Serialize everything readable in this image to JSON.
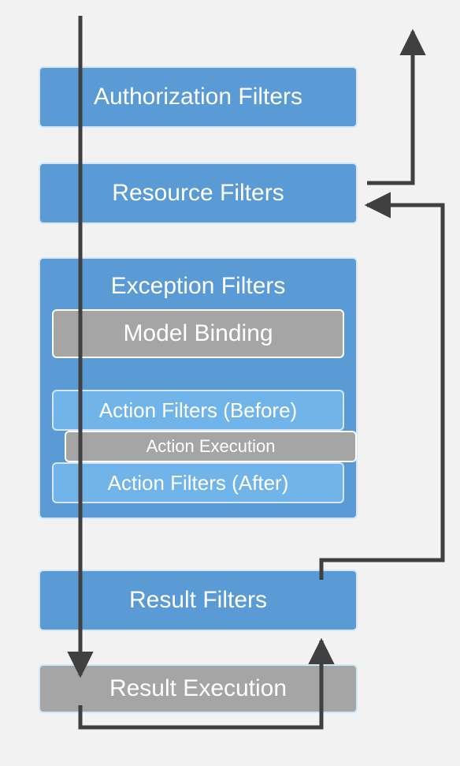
{
  "colors": {
    "blue": "#5b9bd5",
    "lightBlue": "#71b4ea",
    "gray": "#a5a5a5",
    "bg": "#f2f2f2",
    "arrow": "#404040"
  },
  "boxes": {
    "auth": {
      "label": "Authorization Filters"
    },
    "resource": {
      "label": "Resource Filters"
    },
    "exception": {
      "label": "Exception Filters"
    },
    "modelBinding": {
      "label": "Model Binding"
    },
    "actionBefore": {
      "label": "Action Filters  (Before)"
    },
    "actionExec": {
      "label": "Action Execution"
    },
    "actionAfter": {
      "label": "Action Filters  (After)"
    },
    "resultFilters": {
      "label": "Result Filters"
    },
    "resultExec": {
      "label": "Result Execution"
    }
  },
  "flow": [
    "enter top-left down through all stages into Result Execution",
    "Result Execution -> right -> up into Result Filters right side",
    "Result Filters right side -> up -> into Resource Filters right side",
    "Resource Filters right side -> up -> exit top-right"
  ]
}
